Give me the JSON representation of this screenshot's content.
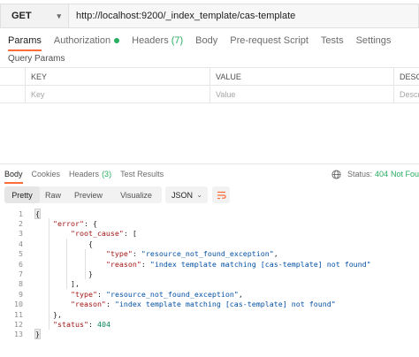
{
  "request": {
    "method": "GET",
    "url": "http://localhost:9200/_index_template/cas-template"
  },
  "request_tabs": [
    {
      "label": "Params"
    },
    {
      "label": "Authorization"
    },
    {
      "label": "Headers",
      "count": "(7)"
    },
    {
      "label": "Body"
    },
    {
      "label": "Pre-request Script"
    },
    {
      "label": "Tests"
    },
    {
      "label": "Settings"
    }
  ],
  "query_params": {
    "title": "Query Params",
    "headers": [
      "KEY",
      "VALUE",
      "DESCRI"
    ],
    "placeholders": [
      "Key",
      "Value",
      "Descr"
    ]
  },
  "response_tabs": [
    {
      "label": "Body"
    },
    {
      "label": "Cookies"
    },
    {
      "label": "Headers",
      "count": "(3)"
    },
    {
      "label": "Test Results"
    }
  ],
  "status": {
    "label": "Status:",
    "code": "404",
    "text": "Not Fou"
  },
  "view_modes": [
    "Pretty",
    "Raw",
    "Preview",
    "Visualize"
  ],
  "format": "JSON",
  "code_lines": [
    {
      "n": "1",
      "parts": [
        [
          "txt",
          "{"
        ]
      ]
    },
    {
      "n": "2",
      "parts": [
        [
          "txt",
          "    "
        ],
        [
          "k",
          "\"error\""
        ],
        [
          "txt",
          ": {"
        ]
      ]
    },
    {
      "n": "3",
      "parts": [
        [
          "txt",
          "        "
        ],
        [
          "k",
          "\"root_cause\""
        ],
        [
          "txt",
          ": ["
        ]
      ]
    },
    {
      "n": "4",
      "parts": [
        [
          "txt",
          "            {"
        ]
      ]
    },
    {
      "n": "5",
      "parts": [
        [
          "txt",
          "                "
        ],
        [
          "k",
          "\"type\""
        ],
        [
          "txt",
          ": "
        ],
        [
          "s",
          "\"resource_not_found_exception\""
        ],
        [
          "txt",
          ","
        ]
      ]
    },
    {
      "n": "6",
      "parts": [
        [
          "txt",
          "                "
        ],
        [
          "k",
          "\"reason\""
        ],
        [
          "txt",
          ": "
        ],
        [
          "s",
          "\"index template matching [cas-template] not found\""
        ]
      ]
    },
    {
      "n": "7",
      "parts": [
        [
          "txt",
          "            }"
        ]
      ]
    },
    {
      "n": "8",
      "parts": [
        [
          "txt",
          "        ],"
        ]
      ]
    },
    {
      "n": "9",
      "parts": [
        [
          "txt",
          "        "
        ],
        [
          "k",
          "\"type\""
        ],
        [
          "txt",
          ": "
        ],
        [
          "s",
          "\"resource_not_found_exception\""
        ],
        [
          "txt",
          ","
        ]
      ]
    },
    {
      "n": "10",
      "parts": [
        [
          "txt",
          "        "
        ],
        [
          "k",
          "\"reason\""
        ],
        [
          "txt",
          ": "
        ],
        [
          "s",
          "\"index template matching [cas-template] not found\""
        ]
      ]
    },
    {
      "n": "11",
      "parts": [
        [
          "txt",
          "    },"
        ]
      ]
    },
    {
      "n": "12",
      "parts": [
        [
          "txt",
          "    "
        ],
        [
          "k",
          "\"status\""
        ],
        [
          "txt",
          ": "
        ],
        [
          "n",
          "404"
        ]
      ]
    },
    {
      "n": "13",
      "parts": [
        [
          "txt",
          "}"
        ]
      ]
    }
  ],
  "colors": {
    "accent": "#ff6c37",
    "success": "#27ae60",
    "json_key": "#a31515",
    "json_string": "#0451a5",
    "json_number": "#098658"
  },
  "icons": [
    "chevron-down-icon",
    "status-dot-icon",
    "globe-icon",
    "wrap-lines-icon"
  ]
}
